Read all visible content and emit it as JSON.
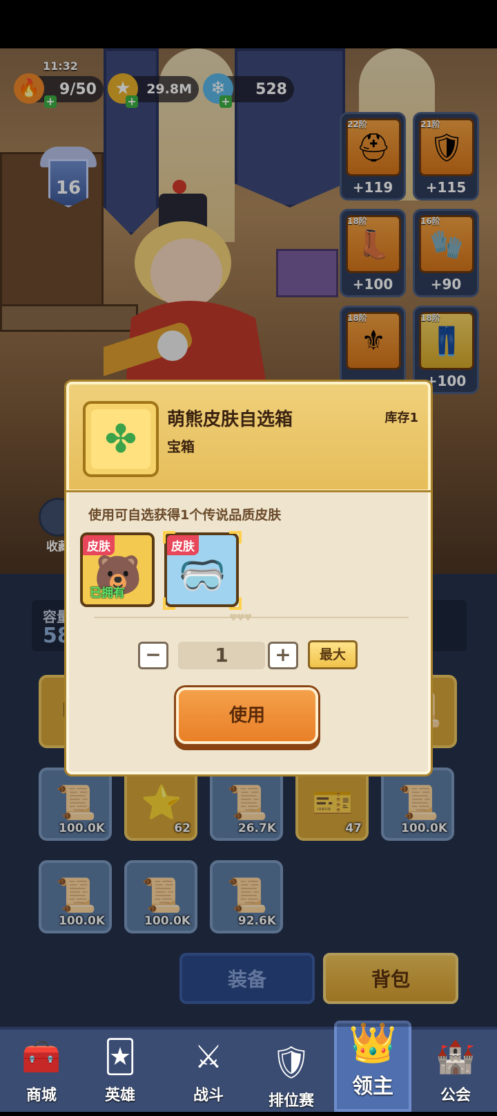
{
  "status_bar": {
    "time": "11:32"
  },
  "resources": {
    "stamina": {
      "value": "9/50",
      "icon": "fire-icon"
    },
    "gold": {
      "value": "29.8M",
      "icon": "coin-icon"
    },
    "gems": {
      "value": "528",
      "icon": "crystal-icon"
    }
  },
  "player": {
    "rank_level": "16"
  },
  "equipment": [
    {
      "tier": "22阶",
      "value": "+119",
      "icon": "helmet-icon",
      "frame": "orange"
    },
    {
      "tier": "21阶",
      "value": "+115",
      "icon": "armor-icon",
      "frame": "orange"
    },
    {
      "tier": "18阶",
      "value": "+100",
      "icon": "boots-icon",
      "frame": "orange"
    },
    {
      "tier": "16阶",
      "value": "+90",
      "icon": "gauntlet-icon",
      "frame": "orange"
    },
    {
      "tier": "18阶",
      "value": "",
      "icon": "shoulder-icon",
      "frame": "orange"
    },
    {
      "tier": "18阶",
      "value": "+100",
      "icon": "pants-icon",
      "frame": "gold"
    }
  ],
  "side": {
    "collection_label": "收藏"
  },
  "bag": {
    "capacity_label": "容量",
    "capacity_value": "58",
    "items": [
      {
        "count": "100.0K",
        "icon": "scroll-pants-icon",
        "frame": "blue"
      },
      {
        "count": "62",
        "icon": "star-scroll-icon",
        "frame": "gold"
      },
      {
        "count": "26.7K",
        "icon": "scroll-pants-icon",
        "frame": "blue"
      },
      {
        "count": "47",
        "icon": "ticket-icon",
        "frame": "gold"
      },
      {
        "count": "100.0K",
        "icon": "scroll-pants-icon",
        "frame": "blue"
      },
      {
        "count": "100.0K",
        "icon": "scroll-pants-icon",
        "frame": "blue"
      },
      {
        "count": "100.0K",
        "icon": "scroll-helmet-icon",
        "frame": "blue"
      },
      {
        "count": "92.6K",
        "icon": "scroll-glove-icon",
        "frame": "blue"
      }
    ],
    "tab_equip": "装备",
    "tab_backpack": "背包"
  },
  "nav": [
    {
      "label": "商城",
      "icon": "shop-icon"
    },
    {
      "label": "英雄",
      "icon": "hero-card-icon"
    },
    {
      "label": "战斗",
      "icon": "crossed-swords-icon"
    },
    {
      "label": "排位赛",
      "icon": "rank-shield-icon"
    },
    {
      "label": "领主",
      "icon": "crown-banner-icon",
      "active": true
    },
    {
      "label": "公会",
      "icon": "guild-tower-icon"
    }
  ],
  "modal": {
    "title": "萌熊皮肤自选箱",
    "subtitle": "宝箱",
    "stock": "库存1",
    "description": "使用可自选获得1个传说品质皮肤",
    "skins": [
      {
        "tag": "皮肤",
        "status": "已拥有",
        "icon": "bear-skin-icon"
      },
      {
        "tag": "皮肤",
        "status": "",
        "icon": "goggles-hero-icon",
        "selected": true
      }
    ],
    "quantity": "1",
    "minus_label": "−",
    "plus_label": "+",
    "max_label": "最大",
    "use_label": "使用",
    "chest_icon": "clover-chest-icon"
  },
  "colors": {
    "accent_gold": "#e6bd5a",
    "use_button": "#e98028",
    "navbar": "#3a4c72"
  }
}
